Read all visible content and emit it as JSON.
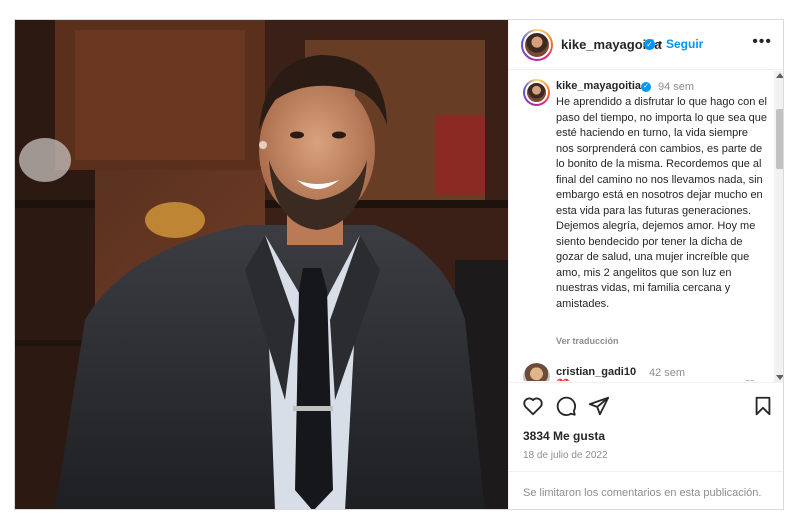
{
  "post": {
    "username": "kike_mayagoitia",
    "follow_label": "Seguir",
    "more_label": "•••",
    "separator": "•",
    "verified_mark": "✓"
  },
  "caption": {
    "username": "kike_mayagoitia",
    "time": "94 sem",
    "text": "He aprendido a disfrutar lo que hago con el paso del tiempo, no importa lo que sea que esté haciendo en turno, la vida siempre nos sorprenderá con cambios, es parte de lo bonito de la misma. Recordemos que al final del camino no nos llevamos nada, sin embargo está en nosotros dejar mucho en esta vida para las futuras generaciones. Dejemos alegría, dejemos amor. Hoy me siento bendecido por tener la dicha de gozar de salud, una mujer increíble que amo, mis 2 angelitos que son luz en nuestras vidas, mi familia cercana y amistades.",
    "translate_label": "Ver traducción"
  },
  "comment": {
    "username": "cristian_gadi10",
    "time": "42 sem",
    "text": "❤️"
  },
  "stats": {
    "likes": "3834 Me gusta",
    "date": "18 de julio de 2022"
  },
  "footer": {
    "text": "Se limitaron los comentarios en esta publicación."
  },
  "icons": {
    "like": "heart-outline-icon",
    "comment": "comment-bubble-icon",
    "share": "paper-plane-icon",
    "save": "bookmark-icon"
  },
  "colors": {
    "accent": "#0095f6",
    "heart": "#ed4956",
    "muted": "#8e8e8e",
    "text": "#262626"
  }
}
